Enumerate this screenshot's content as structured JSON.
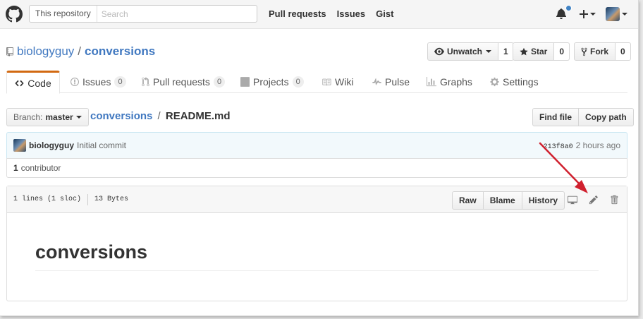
{
  "header": {
    "search_scope": "This repository",
    "search_placeholder": "Search",
    "nav": [
      "Pull requests",
      "Issues",
      "Gist"
    ]
  },
  "repo": {
    "owner": "biologyguy",
    "name": "conversions",
    "actions": {
      "watch_label": "Unwatch",
      "watch_count": "1",
      "star_label": "Star",
      "star_count": "0",
      "fork_label": "Fork",
      "fork_count": "0"
    }
  },
  "tabs": {
    "code": "Code",
    "issues": "Issues",
    "issues_count": "0",
    "pulls": "Pull requests",
    "pulls_count": "0",
    "projects": "Projects",
    "projects_count": "0",
    "wiki": "Wiki",
    "pulse": "Pulse",
    "graphs": "Graphs",
    "settings": "Settings"
  },
  "filenav": {
    "branch_label": "Branch:",
    "branch_value": "master",
    "breadcrumb_repo": "conversions",
    "breadcrumb_sep": "/",
    "breadcrumb_file": "README.md",
    "find_file": "Find file",
    "copy_path": "Copy path"
  },
  "commit": {
    "author": "biologyguy",
    "message": "Initial commit",
    "sha": "213f8a0",
    "time": "2 hours ago"
  },
  "contributors": {
    "count": "1",
    "label": "contributor"
  },
  "file": {
    "lines": "1 lines (1 sloc)",
    "size": "13 Bytes",
    "raw": "Raw",
    "blame": "Blame",
    "history": "History",
    "readme_heading": "conversions"
  },
  "colors": {
    "link": "#4078c0",
    "tab_accent": "#d26911",
    "annotation_arrow": "#d0202e"
  },
  "icons": [
    "github-logo-icon",
    "bell-icon",
    "plus-icon",
    "repo-icon",
    "eye-icon",
    "star-icon",
    "fork-icon",
    "code-icon",
    "issue-icon",
    "pull-request-icon",
    "project-icon",
    "book-icon",
    "pulse-icon",
    "graph-icon",
    "gear-icon",
    "desktop-icon",
    "pencil-icon",
    "trash-icon"
  ]
}
